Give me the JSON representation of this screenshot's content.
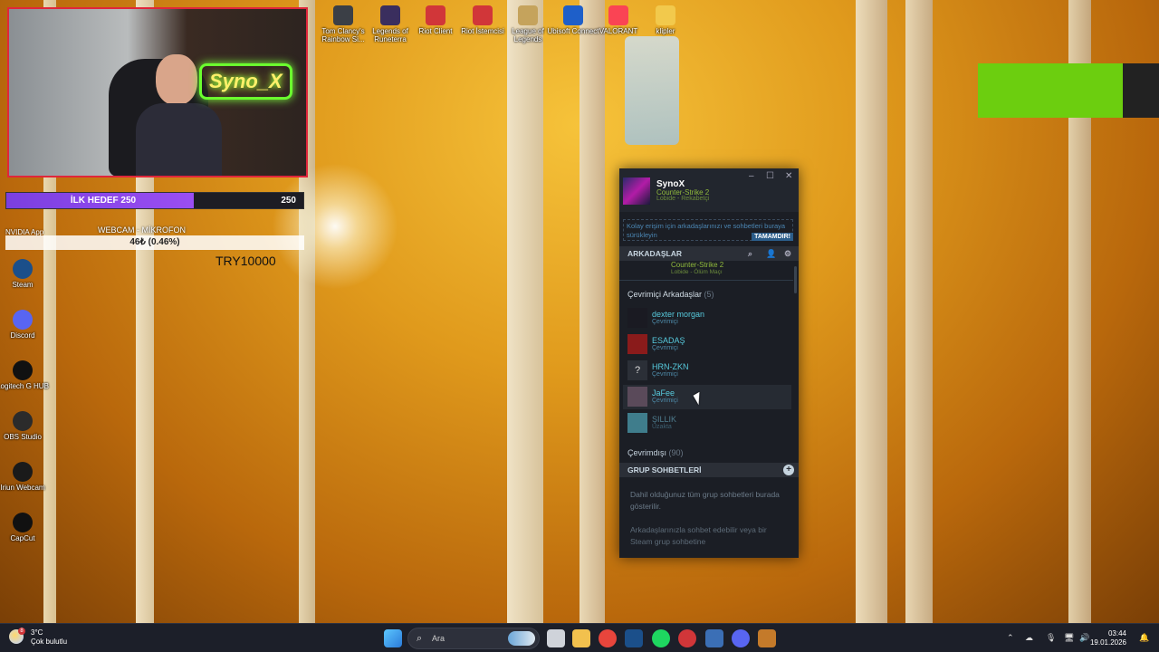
{
  "desktop_icons_top": [
    {
      "label": "Tom Clancy's Rainbow Si...",
      "color": "#3b3f46"
    },
    {
      "label": "Legends of Runeterra",
      "color": "#3a2e5e"
    },
    {
      "label": "Riot Client",
      "color": "#d13639"
    },
    {
      "label": "Riot İstemcisi",
      "color": "#d13639"
    },
    {
      "label": "League of Legends",
      "color": "#c5a35c"
    },
    {
      "label": "Ubisoft Connect",
      "color": "#1e5fc9"
    },
    {
      "label": "VALORANT",
      "color": "#fa4454"
    },
    {
      "label": "klipler",
      "color": "#f2c94c"
    }
  ],
  "desktop_icons_left": [
    {
      "label": "Steam",
      "color": "#1b4f8a"
    },
    {
      "label": "Discord",
      "color": "#5865f2"
    },
    {
      "label": "Logitech G HUB",
      "color": "#111111"
    },
    {
      "label": "OBS Studio",
      "color": "#2b2b2b"
    },
    {
      "label": "Iriun Webcam",
      "color": "#1a1a1a"
    },
    {
      "label": "CapCut",
      "color": "#111111"
    }
  ],
  "overlay": {
    "webcam_neon": "Syno_X",
    "goal_label": "İLK HEDEF 250",
    "goal_value": "250",
    "goal_progress": 0.63,
    "cam_label": "WEBCAM - MİKROFON",
    "nvidia_label": "NVIDIA App",
    "tip_text": "46₺ (0.46%)",
    "tip_goal": "TRY10000"
  },
  "steam": {
    "username": "SynoX",
    "user_game": "Counter-Strike 2",
    "user_status": "Lobide - Rekabetçi",
    "tip": "Kolay erişim için arkadaşlarınızı ve sohbetleri buraya sürükleyin",
    "tip_button": "TAMAMDIR!",
    "friends_header": "ARKADAŞLAR",
    "prev_game": "Counter-Strike 2",
    "prev_status": "Lobide - Ölüm Maçı",
    "online_title": "Çevrimiçi Arkadaşlar",
    "online_count": "(5)",
    "friends": [
      {
        "name": "dexter morgan",
        "status": "Çevrimiçi",
        "avatar": "#1a1a22",
        "glyph": ""
      },
      {
        "name": "ESADAŞ",
        "status": "Çevrimiçi",
        "avatar": "#8a1b1b",
        "glyph": ""
      },
      {
        "name": "HRN-ZKN",
        "status": "Çevrimiçi",
        "avatar": "#2b2f37",
        "glyph": "?"
      },
      {
        "name": "JaFee",
        "status": "Çevrimiçi",
        "avatar": "#5a4a5a",
        "glyph": ""
      },
      {
        "name": "ŞILLIK",
        "status": "Uzakta",
        "avatar": "#3f7d8c",
        "glyph": ""
      }
    ],
    "offline_title": "Çevrimdışı",
    "offline_count": "(90)",
    "groups_header": "GRUP SOHBETLERİ",
    "groups_text": "Dahil olduğunuz tüm grup sohbetleri burada gösterilir.",
    "groups_text2": "Arkadaşlarınızla sohbet edebilir veya bir Steam grup sohbetine"
  },
  "taskbar": {
    "weather_temp": "3°C",
    "weather_desc": "Çok bulutlu",
    "weather_badge": "8",
    "search_placeholder": "Ara",
    "time": "03:44",
    "date": "19.01.2026",
    "apps": [
      {
        "name": "windows-start",
        "color": "#3aa0ff"
      },
      {
        "name": "task-view",
        "color": "#cfd3da"
      },
      {
        "name": "file-explorer",
        "color": "#f2c14e"
      },
      {
        "name": "chrome",
        "color": "#e8453c"
      },
      {
        "name": "steam",
        "color": "#1b4f8a"
      },
      {
        "name": "spotify",
        "color": "#1ed760"
      },
      {
        "name": "riot",
        "color": "#d13639"
      },
      {
        "name": "game-app",
        "color": "#3b6fb6"
      },
      {
        "name": "discord",
        "color": "#5865f2"
      },
      {
        "name": "obs",
        "color": "#c47a2a"
      }
    ]
  }
}
